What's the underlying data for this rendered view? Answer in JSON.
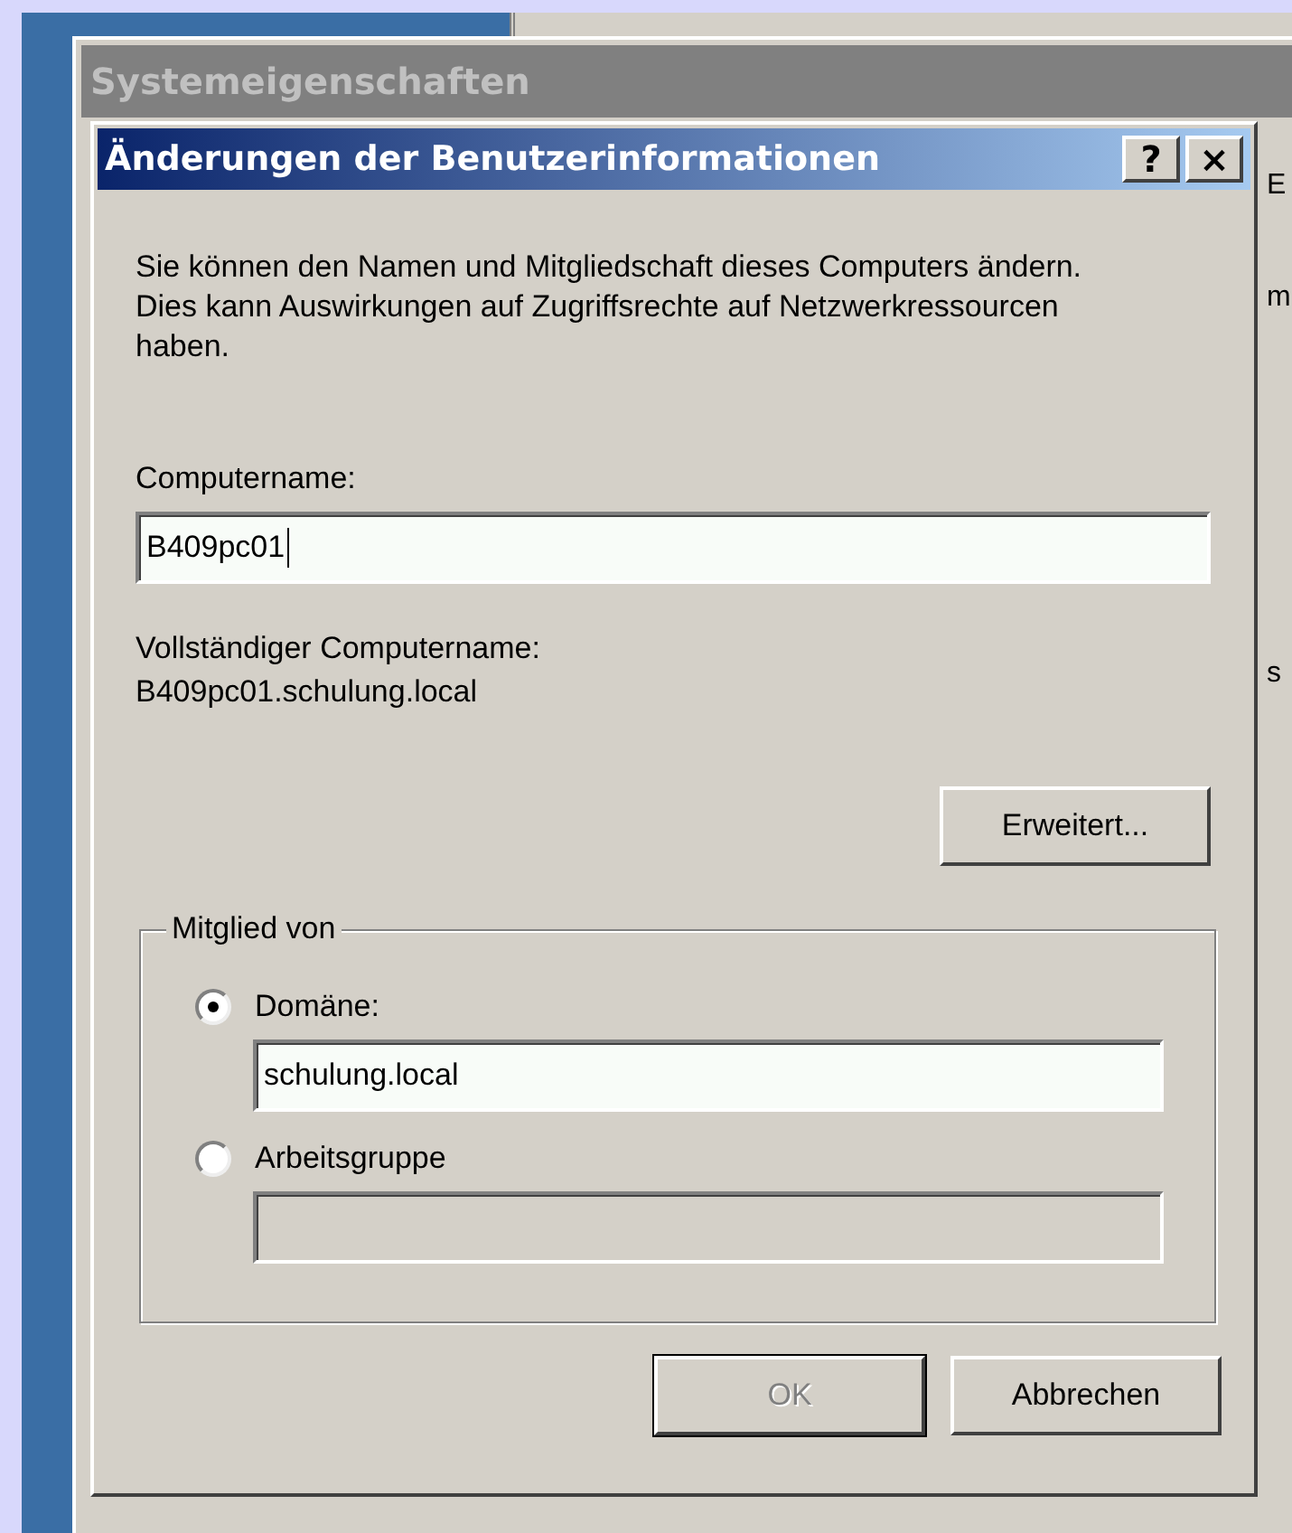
{
  "background_window": {
    "title": "Systemeigenschaften",
    "cut_texts": [
      "E",
      "m",
      "s"
    ]
  },
  "dialog": {
    "title": "Änderungen der Benutzerinformationen",
    "title_buttons": [
      "?",
      "×"
    ],
    "description": "Sie können den Namen und Mitgliedschaft dieses Computers ändern. Dies kann Auswirkungen auf Zugriffsrechte auf Netzwerkressourcen haben.",
    "computer_name_label": "Computername:",
    "computer_name_value": "B409pc01",
    "full_name_label": "Vollständiger Computername:",
    "full_name_value": "B409pc01.schulung.local",
    "advanced_button": {
      "label": "Erweitert..."
    },
    "member_of": {
      "legend": "Mitglied von",
      "options": [
        {
          "label": "Domäne:",
          "selected": true,
          "value": "schulung.local"
        },
        {
          "label": "Arbeitsgruppe",
          "selected": false
        }
      ]
    },
    "buttons": [
      {
        "label": "OK",
        "disabled": true,
        "default": true
      },
      {
        "label": "Abbrechen",
        "disabled": false,
        "default": false
      }
    ]
  }
}
